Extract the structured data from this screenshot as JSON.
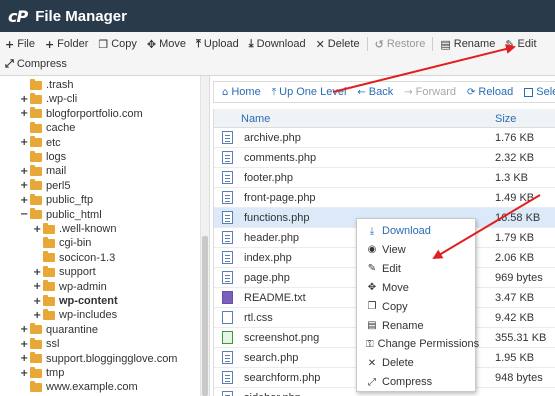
{
  "app": {
    "logo": "cP",
    "title": "File Manager"
  },
  "toolbar": {
    "row1": [
      {
        "icon": "+",
        "label": "File",
        "disabled": false
      },
      {
        "icon": "+",
        "label": "Folder",
        "disabled": false
      },
      {
        "icon": "❐",
        "label": "Copy",
        "disabled": false
      },
      {
        "icon": "✥",
        "label": "Move",
        "disabled": false
      },
      {
        "icon": "⤒",
        "label": "Upload",
        "disabled": false
      },
      {
        "icon": "⤓",
        "label": "Download",
        "disabled": false
      },
      {
        "icon": "✕",
        "label": "Delete",
        "disabled": false
      },
      {
        "icon": "↺",
        "label": "Restore",
        "disabled": true
      },
      {
        "icon": "▤",
        "label": "Rename",
        "disabled": false
      },
      {
        "icon": "✎",
        "label": "Edit",
        "disabled": false
      }
    ],
    "row2": [
      {
        "icon": "⤢",
        "label": "Compress",
        "disabled": false
      }
    ]
  },
  "tree": [
    {
      "label": ".trash",
      "expander": "",
      "bold": false
    },
    {
      "label": ".wp-cli",
      "expander": "+",
      "bold": false
    },
    {
      "label": "blogforportfolio.com",
      "expander": "+",
      "bold": false
    },
    {
      "label": "cache",
      "expander": "",
      "bold": false
    },
    {
      "label": "etc",
      "expander": "+",
      "bold": false
    },
    {
      "label": "logs",
      "expander": "",
      "bold": false
    },
    {
      "label": "mail",
      "expander": "+",
      "bold": false
    },
    {
      "label": "perl5",
      "expander": "+",
      "bold": false
    },
    {
      "label": "public_ftp",
      "expander": "+",
      "bold": false
    },
    {
      "label": "public_html",
      "expander": "−",
      "bold": false
    },
    {
      "label": ".well-known",
      "expander": "+",
      "bold": false
    },
    {
      "label": "cgi-bin",
      "expander": "",
      "bold": false
    },
    {
      "label": "socicon-1.3",
      "expander": "",
      "bold": false
    },
    {
      "label": "support",
      "expander": "+",
      "bold": false
    },
    {
      "label": "wp-admin",
      "expander": "+",
      "bold": false
    },
    {
      "label": "wp-content",
      "expander": "+",
      "bold": true
    },
    {
      "label": "wp-includes",
      "expander": "+",
      "bold": false
    },
    {
      "label": "quarantine",
      "expander": "+",
      "bold": false
    },
    {
      "label": "ssl",
      "expander": "+",
      "bold": false
    },
    {
      "label": "support.bloggingglove.com",
      "expander": "+",
      "bold": false
    },
    {
      "label": "tmp",
      "expander": "+",
      "bold": false
    },
    {
      "label": "www.example.com",
      "expander": "",
      "bold": false
    }
  ],
  "nav": [
    {
      "icon": "⌂",
      "label": "Home",
      "disabled": false
    },
    {
      "icon": "⤒",
      "label": "Up One Level",
      "disabled": false
    },
    {
      "icon": "←",
      "label": "Back",
      "disabled": false
    },
    {
      "icon": "→",
      "label": "Forward",
      "disabled": true
    },
    {
      "icon": "⟳",
      "label": "Reload",
      "disabled": false
    },
    {
      "icon": "",
      "label": "Selec",
      "disabled": false
    }
  ],
  "table": {
    "headers": {
      "name": "Name",
      "size": "Size"
    },
    "rows": [
      {
        "name": "archive.php",
        "size": "1.76 KB",
        "type": "php",
        "selected": false
      },
      {
        "name": "comments.php",
        "size": "2.32 KB",
        "type": "php",
        "selected": false
      },
      {
        "name": "footer.php",
        "size": "1.3 KB",
        "type": "php",
        "selected": false
      },
      {
        "name": "front-page.php",
        "size": "1.49 KB",
        "type": "php",
        "selected": false
      },
      {
        "name": "functions.php",
        "size": "16.58 KB",
        "type": "php",
        "selected": true
      },
      {
        "name": "header.php",
        "size": "1.79 KB",
        "type": "php",
        "selected": false
      },
      {
        "name": "index.php",
        "size": "2.06 KB",
        "type": "php",
        "selected": false
      },
      {
        "name": "page.php",
        "size": "969 bytes",
        "type": "php",
        "selected": false
      },
      {
        "name": "README.txt",
        "size": "3.47 KB",
        "type": "txt",
        "selected": false
      },
      {
        "name": "rtl.css",
        "size": "9.42 KB",
        "type": "css",
        "selected": false
      },
      {
        "name": "screenshot.png",
        "size": "355.31 KB",
        "type": "png",
        "selected": false
      },
      {
        "name": "search.php",
        "size": "1.95 KB",
        "type": "php",
        "selected": false
      },
      {
        "name": "searchform.php",
        "size": "948 bytes",
        "type": "php",
        "selected": false
      },
      {
        "name": "sidebar.php",
        "size": "",
        "type": "php",
        "selected": false
      }
    ]
  },
  "context_menu": [
    {
      "icon": "⤓",
      "label": "Download"
    },
    {
      "icon": "◉",
      "label": "View"
    },
    {
      "icon": "✎",
      "label": "Edit"
    },
    {
      "icon": "✥",
      "label": "Move"
    },
    {
      "icon": "❐",
      "label": "Copy"
    },
    {
      "icon": "▤",
      "label": "Rename"
    },
    {
      "icon": "⚿",
      "label": "Change Permissions"
    },
    {
      "icon": "✕",
      "label": "Delete"
    },
    {
      "icon": "⤢",
      "label": "Compress"
    }
  ],
  "colors": {
    "titlebar": "#293a4a",
    "link": "#2a6cb5",
    "folder": "#e8a838",
    "selected_row": "#dbe9f8",
    "arrow": "#e02020"
  }
}
